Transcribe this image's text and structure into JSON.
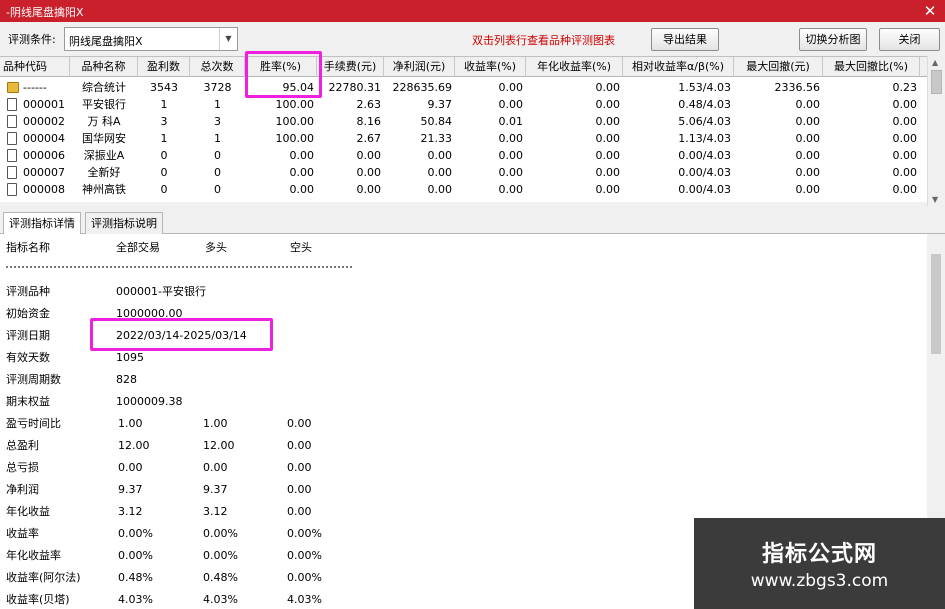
{
  "window": {
    "title": "-阴线尾盘擒阳X",
    "close_glyph": "✕"
  },
  "toolbar": {
    "condition_label": "评测条件:",
    "condition_value": "阴线尾盘擒阳X",
    "hint": "双击列表行查看品种评测图表",
    "export_label": "导出结果",
    "switch_label": "切换分析图",
    "close_label": "关闭"
  },
  "table": {
    "columns": [
      "品种代码",
      "品种名称",
      "盈利数",
      "总次数",
      "胜率(%)",
      "手续费(元)",
      "净利润(元)",
      "收益率(%)",
      "年化收益率(%)",
      "相对收益率α/β(%)",
      "最大回撤(元)",
      "最大回撤比(%)"
    ],
    "rows": [
      {
        "code": "------",
        "name": "综合统计",
        "wins": "3543",
        "total": "3728",
        "winrate": "95.04",
        "fee": "22780.31",
        "net": "228635.69",
        "ret": "0.00",
        "annual": "0.00",
        "rel": "1.53/4.03",
        "maxdd": "2336.56",
        "maxddpct": "0.23",
        "icon": "summary-icon"
      },
      {
        "code": "000001",
        "name": "平安银行",
        "wins": "1",
        "total": "1",
        "winrate": "100.00",
        "fee": "2.63",
        "net": "9.37",
        "ret": "0.00",
        "annual": "0.00",
        "rel": "0.48/4.03",
        "maxdd": "0.00",
        "maxddpct": "0.00",
        "icon": "document-icon"
      },
      {
        "code": "000002",
        "name": "万 科A",
        "wins": "3",
        "total": "3",
        "winrate": "100.00",
        "fee": "8.16",
        "net": "50.84",
        "ret": "0.01",
        "annual": "0.00",
        "rel": "5.06/4.03",
        "maxdd": "0.00",
        "maxddpct": "0.00",
        "icon": "document-icon"
      },
      {
        "code": "000004",
        "name": "国华网安",
        "wins": "1",
        "total": "1",
        "winrate": "100.00",
        "fee": "2.67",
        "net": "21.33",
        "ret": "0.00",
        "annual": "0.00",
        "rel": "1.13/4.03",
        "maxdd": "0.00",
        "maxddpct": "0.00",
        "icon": "document-icon"
      },
      {
        "code": "000006",
        "name": "深振业A",
        "wins": "0",
        "total": "0",
        "winrate": "0.00",
        "fee": "0.00",
        "net": "0.00",
        "ret": "0.00",
        "annual": "0.00",
        "rel": "0.00/4.03",
        "maxdd": "0.00",
        "maxddpct": "0.00",
        "icon": "document-icon"
      },
      {
        "code": "000007",
        "name": "全新好",
        "wins": "0",
        "total": "0",
        "winrate": "0.00",
        "fee": "0.00",
        "net": "0.00",
        "ret": "0.00",
        "annual": "0.00",
        "rel": "0.00/4.03",
        "maxdd": "0.00",
        "maxddpct": "0.00",
        "icon": "document-icon"
      },
      {
        "code": "000008",
        "name": "神州高铁",
        "wins": "0",
        "total": "0",
        "winrate": "0.00",
        "fee": "0.00",
        "net": "0.00",
        "ret": "0.00",
        "annual": "0.00",
        "rel": "0.00/4.03",
        "maxdd": "0.00",
        "maxddpct": "0.00",
        "icon": "document-icon"
      }
    ]
  },
  "tabs": [
    "评测指标详情",
    "评测指标说明"
  ],
  "detail": {
    "header": [
      "指标名称",
      "全部交易",
      "多头",
      "空头"
    ],
    "product_label": "评测品种",
    "product_value": "000001-平安银行",
    "capital_label": "初始资金",
    "capital_value": "1000000.00",
    "date_label": "评测日期",
    "date_value": "2022/03/14-2025/03/14",
    "days_label": "有效天数",
    "days_value": "1095",
    "periods_label": "评测周期数",
    "periods_value": "828",
    "equity_label": "期末权益",
    "equity_value": "1000009.38",
    "metrics": [
      {
        "label": "盈亏时间比",
        "all": "1.00",
        "long": "1.00",
        "short": "0.00"
      },
      {
        "label": "总盈利",
        "all": "12.00",
        "long": "12.00",
        "short": "0.00"
      },
      {
        "label": "总亏损",
        "all": "0.00",
        "long": "0.00",
        "short": "0.00"
      },
      {
        "label": "净利润",
        "all": "9.37",
        "long": "9.37",
        "short": "0.00"
      },
      {
        "label": "年化收益",
        "all": "3.12",
        "long": "3.12",
        "short": "0.00"
      },
      {
        "label": "收益率",
        "all": "0.00%",
        "long": "0.00%",
        "short": "0.00%"
      },
      {
        "label": "年化收益率",
        "all": "0.00%",
        "long": "0.00%",
        "short": "0.00%"
      },
      {
        "label": "收益率(阿尔法)",
        "all": "0.48%",
        "long": "0.48%",
        "short": "0.00%"
      },
      {
        "label": "收益率(贝塔)",
        "all": "4.03%",
        "long": "4.03%",
        "short": "4.03%"
      }
    ]
  },
  "watermark": {
    "title": "指标公式网",
    "url": "www.zbgs3.com"
  },
  "colors": {
    "titlebar": "#c9202b",
    "hint": "#d00000",
    "highlight": "#f020e0"
  }
}
